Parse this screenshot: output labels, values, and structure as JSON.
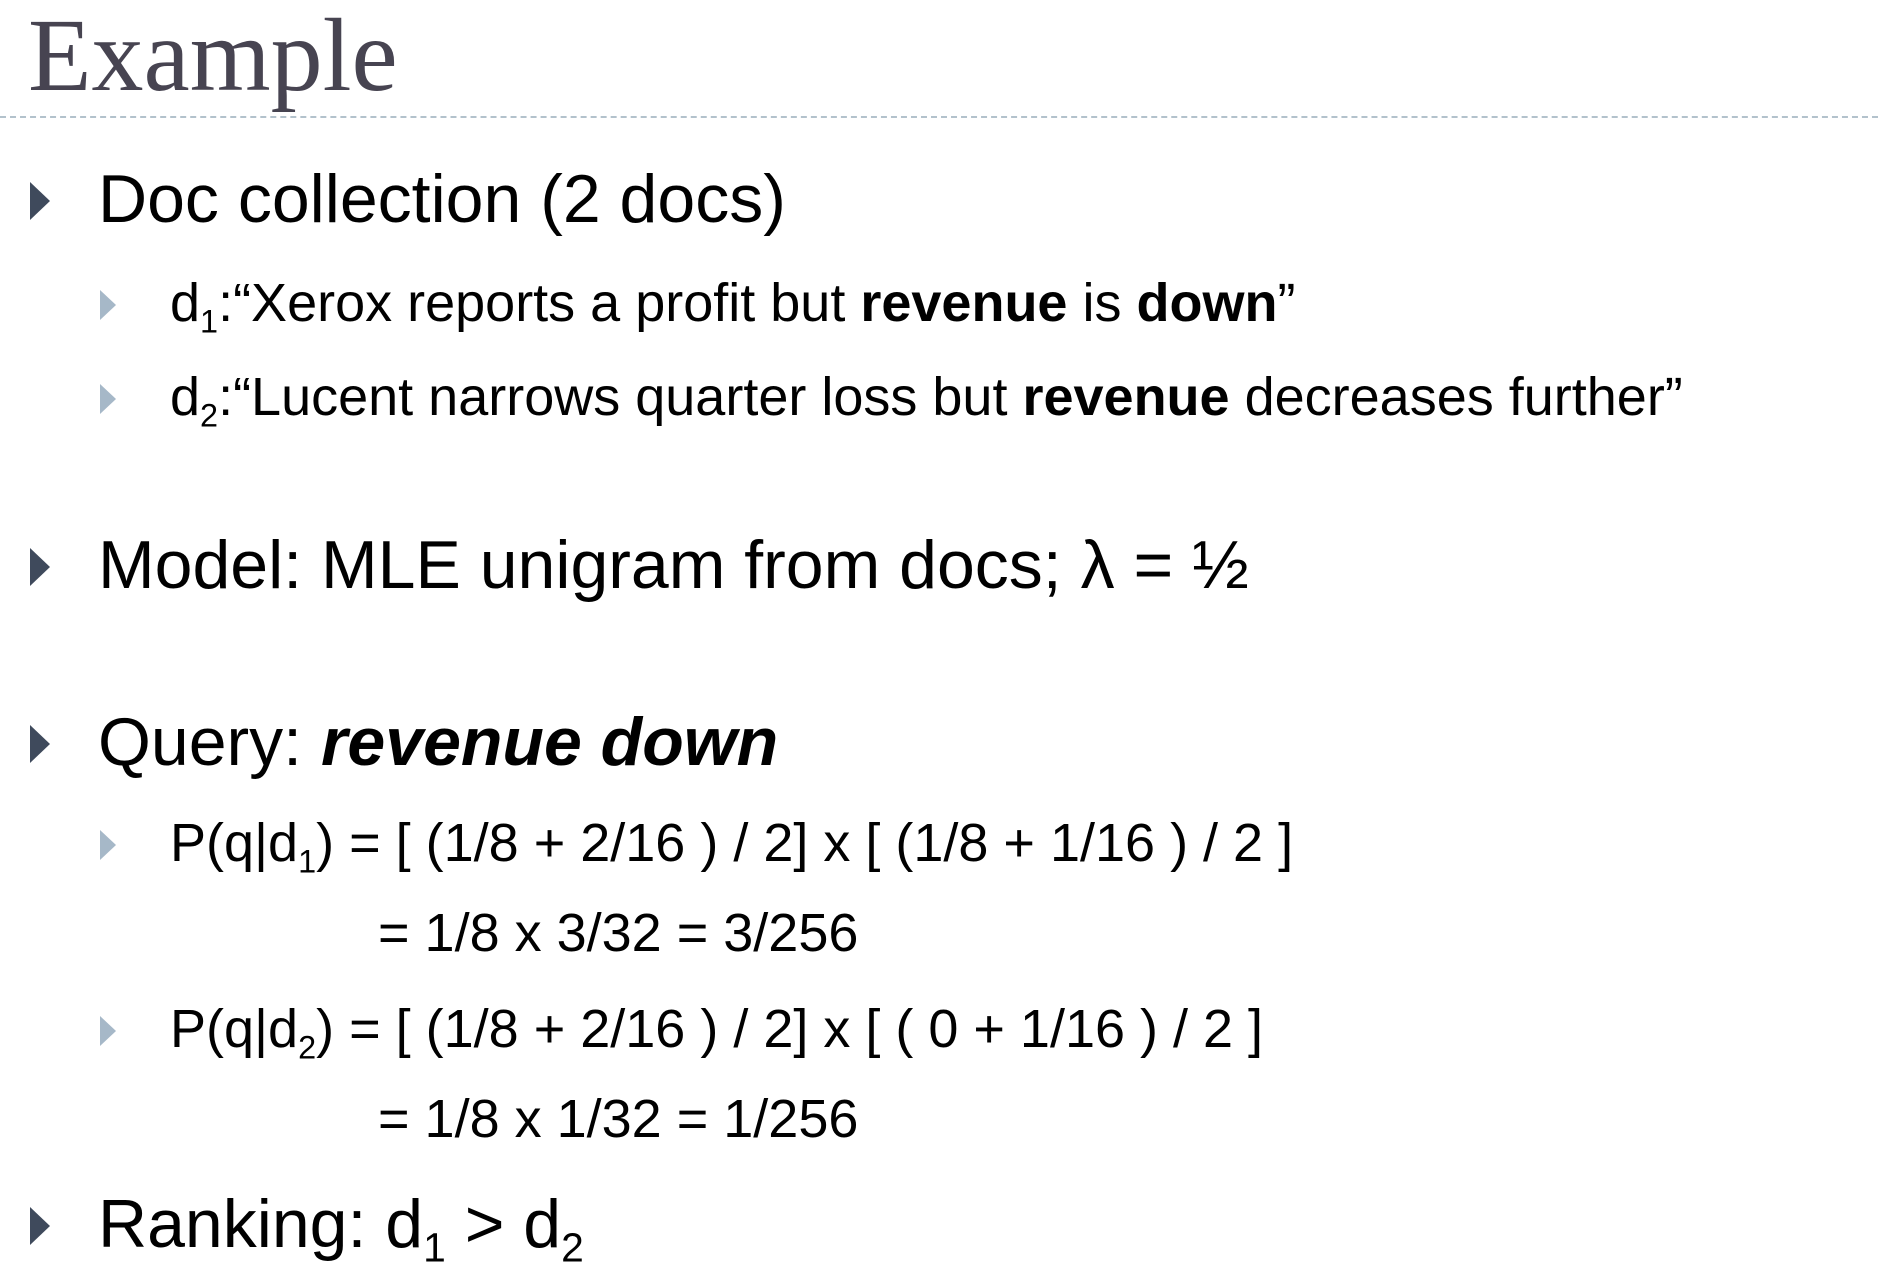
{
  "slide": {
    "title": "Example",
    "collection": {
      "label": "Doc collection (2 docs)",
      "d1": {
        "doc": "d",
        "sub": "1",
        "prefix": ":“Xerox reports a profit but ",
        "w1": "revenue",
        "mid": " is ",
        "w2": "down",
        "suffix": "”"
      },
      "d2": {
        "doc": "d",
        "sub": "2",
        "prefix": ":“Lucent narrows quarter loss but ",
        "w1": "revenue",
        "suffix": " decreases further”"
      }
    },
    "model": "Model: MLE unigram from docs; λ = ½",
    "query": {
      "label": "Query: ",
      "terms": "revenue down"
    },
    "p1": {
      "lhs_a": "P(q|d",
      "sub": "1",
      "lhs_b": ") = [ (1/8 + 2/16 ) / 2]  x  [ (1/8 + 1/16 ) / 2 ]",
      "result": "= 1/8 x 3/32 = 3/256"
    },
    "p2": {
      "lhs_a": "P(q|d",
      "sub": "2",
      "lhs_b": ") = [ (1/8 + 2/16 ) / 2] x [ ( 0 + 1/16 ) / 2 ]",
      "result": "= 1/8 x 1/32 = 1/256"
    },
    "ranking": {
      "label": "Ranking: d",
      "sub1": "1",
      "gt": " > d",
      "sub2": "2"
    }
  }
}
